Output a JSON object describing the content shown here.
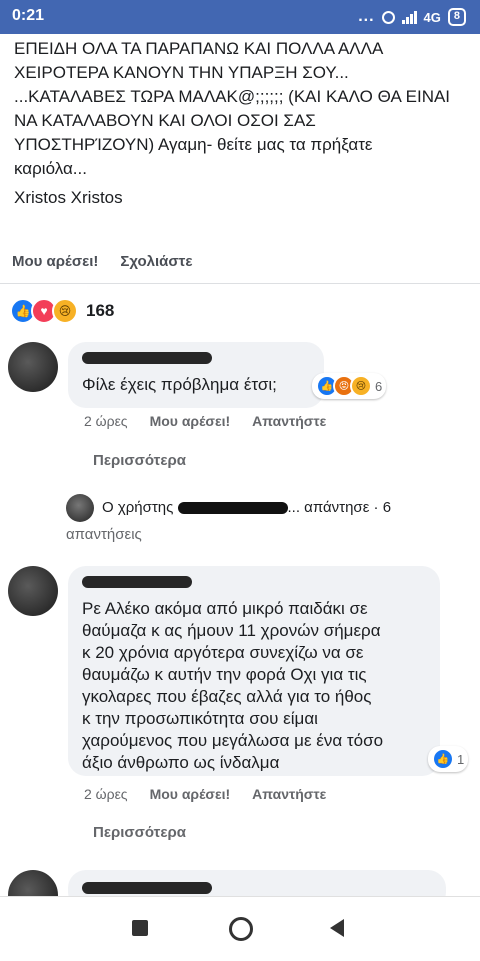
{
  "status_bar": {
    "time": "0:21",
    "dots": "...",
    "network": "4G",
    "battery": "8"
  },
  "post": {
    "text_lines": [
      "ΕΠΕΙΔΗ ΟΛΑ ΤΑ ΠΑΡΑΠΑΝΩ ΚΑΙ ΠΟΛΛΑ ΑΛΛΑ",
      "ΧΕΙΡΟΤΕΡΑ ΚΑΝΟΥΝ ΤΗΝ ΥΠΑΡΞΗ ΣΟΥ...",
      "...ΚΑΤΑΛΑΒΕΣ ΤΩΡΑ ΜΑΛΑΚ@;;;;;; (ΚΑΙ ΚΑΛΟ ΘΑ ΕΙΝΑΙ",
      "ΝΑ ΚΑΤΑΛΑΒΟΥΝ ΚΑΙ ΟΛΟΙ ΟΣΟΙ ΣΑΣ",
      "ΥΠΟΣΤΗΡΊΖΟΥΝ) Αγαμη- θείτε μας τα πρήξατε",
      "καριόλα..."
    ],
    "signature": "Xristos Xristos",
    "like_label": "Μου αρέσει!",
    "comment_label": "Σχολιάστε",
    "reaction_count": "168"
  },
  "comments": [
    {
      "text": "Φίλε έχεις πρόβλημα έτσι;",
      "reaction_count": "6",
      "time": "2 ώρες",
      "like_label": "Μου αρέσει!",
      "reply_label": "Απαντήστε",
      "more_label": "Περισσότερα"
    },
    {
      "text_lines": [
        "Ρε Αλέκο ακόμα από μικρό παιδάκι σε",
        "θαύμαζα κ ας ήμουν 11 χρονών σήμερα",
        "κ 20 χρόνια αργότερα συνεχίζω να σε",
        "θαυμάζω κ αυτήν την φορά Οχι για τις",
        "γκολαρες που έβαζες αλλά για το ήθος",
        "κ την προσωπικότητα σου είμαι",
        "χαρούμενος που μεγάλωσα με ένα τόσο",
        "άξιο άνθρωπο ως ίνδαλμα"
      ],
      "reaction_count": "1",
      "time": "2 ώρες",
      "like_label": "Μου αρέσει!",
      "reply_label": "Απαντήστε",
      "more_label": "Περισσότερα"
    }
  ],
  "reply_summary": {
    "prefix": "Ο χρήστης",
    "suffix": "... απάντησε · 6",
    "second_line": "απαντήσεις"
  },
  "colors": {
    "header": "#4267b2",
    "like": "#1877f2",
    "love": "#f33e58",
    "sad": "#f7b125",
    "angry": "#e9710f"
  }
}
